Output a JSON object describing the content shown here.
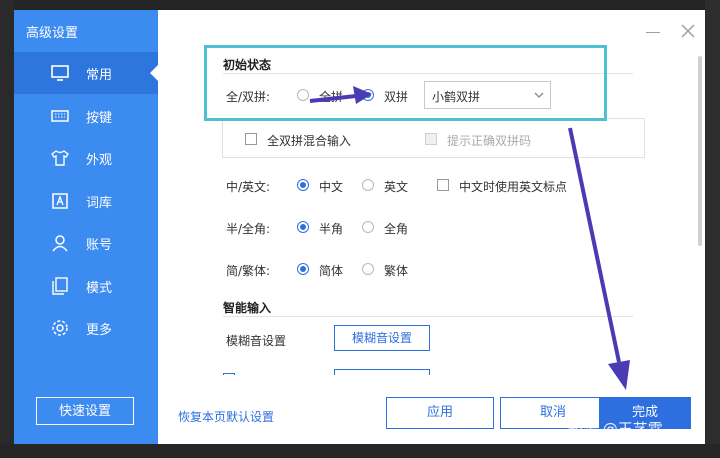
{
  "window": {
    "title": "高级设置"
  },
  "sidebar": {
    "items": [
      {
        "label": "常用",
        "icon": "monitor-icon",
        "active": true
      },
      {
        "label": "按键",
        "icon": "keyboard-icon",
        "active": false
      },
      {
        "label": "外观",
        "icon": "shirt-icon",
        "active": false
      },
      {
        "label": "词库",
        "icon": "dictionary-icon",
        "active": false
      },
      {
        "label": "账号",
        "icon": "user-icon",
        "active": false
      },
      {
        "label": "模式",
        "icon": "mode-icon",
        "active": false
      },
      {
        "label": "更多",
        "icon": "gear-icon",
        "active": false
      }
    ],
    "quick_settings_label": "快速设置"
  },
  "initial_state": {
    "section_title": "初始状态",
    "mode_label": "全/双拼:",
    "options": [
      {
        "label": "全拼",
        "selected": false
      },
      {
        "label": "双拼",
        "selected": true
      }
    ],
    "scheme_select": {
      "value": "小鹤双拼"
    },
    "mixed_input_label": "全双拼混合输入",
    "mixed_input_checked": false,
    "show_shuangpin_code_label": "提示正确双拼码",
    "show_shuangpin_code_enabled": false
  },
  "language": {
    "label": "中/英文:",
    "options": [
      {
        "label": "中文",
        "selected": true
      },
      {
        "label": "英文",
        "selected": false
      }
    ],
    "english_punct_label": "中文时使用英文标点",
    "english_punct_checked": false
  },
  "width": {
    "label": "半/全角:",
    "options": [
      {
        "label": "半角",
        "selected": true
      },
      {
        "label": "全角",
        "selected": false
      }
    ]
  },
  "script": {
    "label": "简/繁体:",
    "options": [
      {
        "label": "简体",
        "selected": true
      },
      {
        "label": "繁体",
        "selected": false
      }
    ]
  },
  "smart_input": {
    "section_title": "智能输入",
    "fuzzy_label": "模糊音设置",
    "fuzzy_button": "模糊音设置"
  },
  "footer": {
    "restore_default": "恢复本页默认设置",
    "apply": "应用",
    "cancel": "取消",
    "done": "完成"
  },
  "watermark": "知乎 @王艺霖",
  "colors": {
    "sidebar": "#3c8bf0",
    "sidebar_active": "#2d76de",
    "accent": "#2e6fe0",
    "highlight_box": "#4ec0d4",
    "annotation_arrow": "#4a3bb5"
  }
}
